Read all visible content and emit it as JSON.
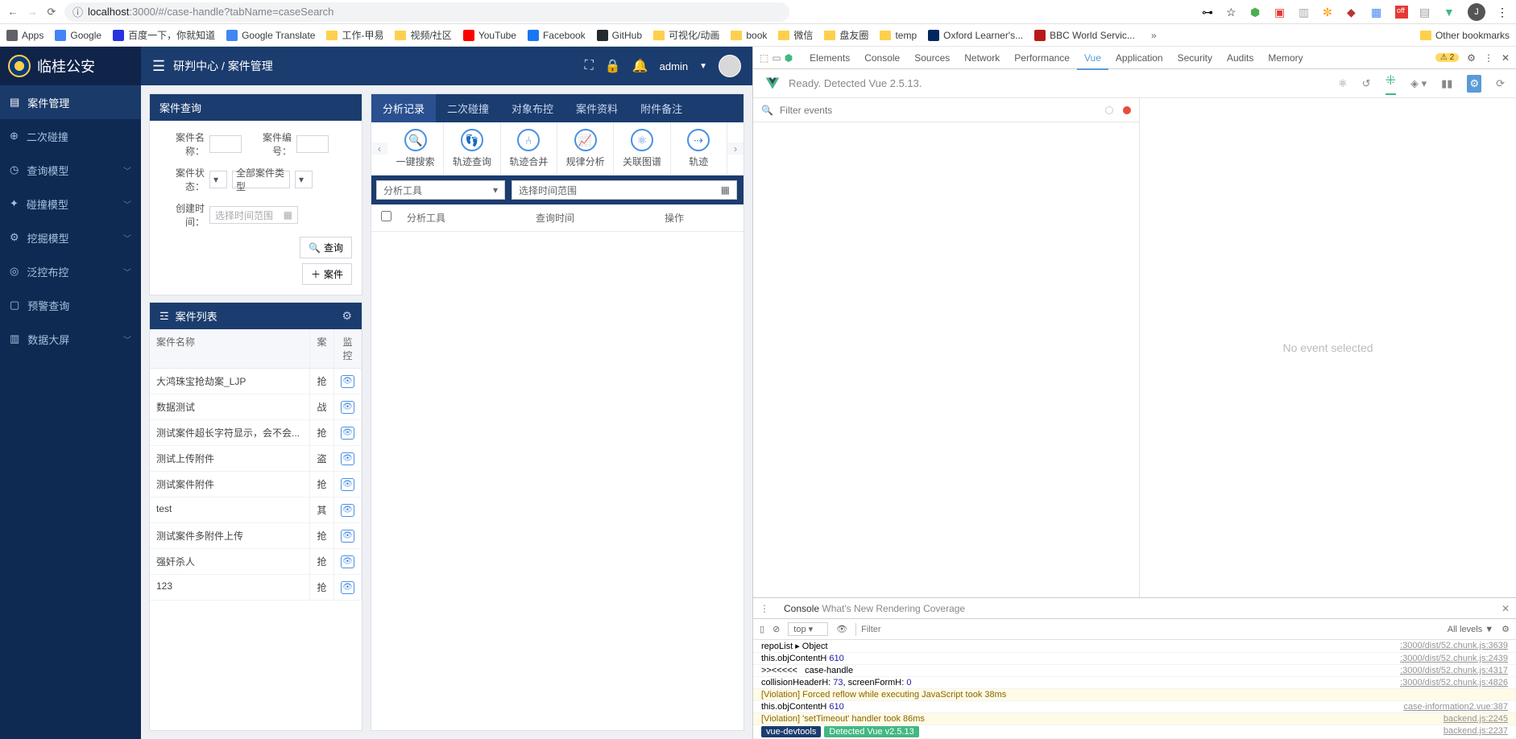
{
  "browser": {
    "url_host": "localhost",
    "url_path": ":3000/#/case-handle?tabName=caseSearch"
  },
  "bookmarks": [
    {
      "label": "Apps",
      "ico": "grid"
    },
    {
      "label": "Google",
      "ico": "g"
    },
    {
      "label": "百度一下，你就知道",
      "ico": "baidu"
    },
    {
      "label": "Google Translate",
      "ico": "gt"
    },
    {
      "label": "工作-甲易",
      "ico": "fold"
    },
    {
      "label": "视频/社区",
      "ico": "fold"
    },
    {
      "label": "YouTube",
      "ico": "yt"
    },
    {
      "label": "Facebook",
      "ico": "fb"
    },
    {
      "label": "GitHub",
      "ico": "gh"
    },
    {
      "label": "可视化/动画",
      "ico": "fold"
    },
    {
      "label": "book",
      "ico": "fold"
    },
    {
      "label": "微信",
      "ico": "fold"
    },
    {
      "label": "盘友圈",
      "ico": "fold"
    },
    {
      "label": "temp",
      "ico": "fold"
    },
    {
      "label": "Oxford Learner's...",
      "ico": "ox"
    },
    {
      "label": "BBC World Servic...",
      "ico": "bbc"
    }
  ],
  "other_bookmarks": "Other bookmarks",
  "app": {
    "title": "临桂公安",
    "crumb1": "研判中心",
    "crumb2": "案件管理",
    "user": "admin",
    "nav": [
      {
        "label": "案件管理",
        "ico": "doc",
        "active": true
      },
      {
        "label": "二次碰撞",
        "ico": "link"
      },
      {
        "label": "查询模型",
        "ico": "clock",
        "sub": true
      },
      {
        "label": "碰撞模型",
        "ico": "spark",
        "sub": true
      },
      {
        "label": "挖掘模型",
        "ico": "gear",
        "sub": true
      },
      {
        "label": "泛控布控",
        "ico": "target",
        "sub": true
      },
      {
        "label": "预警查询",
        "ico": "screen"
      },
      {
        "label": "数据大屏",
        "ico": "graph",
        "sub": true
      }
    ],
    "search_panel": {
      "title": "案件查询",
      "fields": {
        "name": "案件名称：",
        "no": "案件编号：",
        "status": "案件状态：",
        "type": "全部案件类型",
        "time": "创建时间：",
        "time_ph": "选择时间范围"
      },
      "btn_query": "查询",
      "btn_add": "案件"
    },
    "list_panel": {
      "title": "案件列表",
      "cols": {
        "name": "案件名称",
        "cat": "案",
        "mon": "监控"
      },
      "rows": [
        {
          "name": "大鸿珠宝抢劫案_LJP",
          "cat": "抢"
        },
        {
          "name": "数据测试",
          "cat": "战"
        },
        {
          "name": "测试案件超长字符显示，会不会...",
          "cat": "抢"
        },
        {
          "name": "测试上传附件",
          "cat": "盗"
        },
        {
          "name": "测试案件附件",
          "cat": "抢"
        },
        {
          "name": "test",
          "cat": "其"
        },
        {
          "name": "测试案件多附件上传",
          "cat": "抢"
        },
        {
          "name": "强奸杀人",
          "cat": "抢"
        },
        {
          "name": "123",
          "cat": "抢"
        }
      ]
    },
    "main_tabs": [
      "分析记录",
      "二次碰撞",
      "对象布控",
      "案件资料",
      "附件备注"
    ],
    "tools": [
      "一键搜索",
      "轨迹查询",
      "轨迹合并",
      "规律分析",
      "关联图谱",
      "轨迹"
    ],
    "filter1": "分析工具",
    "filter2": "选择时间范围",
    "data_cols": {
      "tool": "分析工具",
      "time": "查询时间",
      "op": "操作"
    }
  },
  "devtools": {
    "tabs": [
      "Elements",
      "Console",
      "Sources",
      "Network",
      "Performance",
      "Vue",
      "Application",
      "Security",
      "Audits",
      "Memory"
    ],
    "active_tab": "Vue",
    "warn_count": "2",
    "vue_ready": "Ready. Detected Vue 2.5.13.",
    "filter_ph": "Filter events",
    "no_event": "No event selected",
    "console_tabs": [
      "Console",
      "What's New",
      "Rendering",
      "Coverage"
    ],
    "top_ctx": "top",
    "filter2_ph": "Filter",
    "levels": "All levels ▼",
    "logs": [
      {
        "msg": "repoList ▸ Object",
        "src": ":3000/dist/52.chunk.js:3639"
      },
      {
        "msg": "this.objContentH 610",
        "src": ":3000/dist/52.chunk.js:2439",
        "num": "610"
      },
      {
        "msg": ">><<<<<   case-handle",
        "src": ":3000/dist/52.chunk.js:4317"
      },
      {
        "msg": "collisionHeaderH: 73, screenFormH: 0",
        "src": ":3000/dist/52.chunk.js:4826"
      },
      {
        "msg": "[Violation] Forced reflow while executing JavaScript took 38ms",
        "viol": true
      },
      {
        "msg": "this.objContentH 610",
        "src": "case-information2.vue:387",
        "num": "610"
      },
      {
        "msg": "[Violation] 'setTimeout' handler took 86ms",
        "viol": true,
        "src": "backend.js:2245"
      },
      {
        "msg": " vue-devtools  Detected Vue v2.5.13 ",
        "src": "backend.js:2237",
        "pill": true
      }
    ]
  }
}
